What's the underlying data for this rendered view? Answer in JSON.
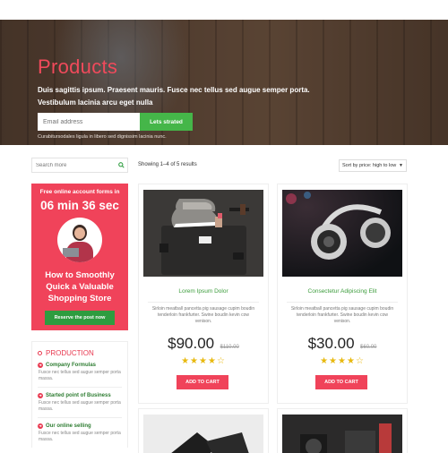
{
  "hero": {
    "title": "Products",
    "text": "Duis sagittis ipsum. Praesent mauris. Fusce nec tellus sed augue semper porta. Vestibulum lacinia arcu eget nulla",
    "email_placeholder": "Email address",
    "button_label": "Lets strated",
    "small_text": "Curabitursodales ligula in libero sed dignissim lacinia nunc."
  },
  "toolbar": {
    "search_placeholder": "Search more",
    "showing_text": "Showing 1–4 of 5 results",
    "sort_label": "Sort by price: high to low"
  },
  "promo": {
    "top_text": "Free online account forms in",
    "timer": "06 min 36 sec",
    "title": "How to Smoothly Quick a Valuable Shopping Store",
    "button_label": "Reserve the post now"
  },
  "sidebar": {
    "heading": "PRODUCTION",
    "items": [
      {
        "title": "Company Formulas",
        "text": "Fusce nec tellus sed augue semper porta massa."
      },
      {
        "title": "Started point of Business",
        "text": "Fusce nec tellus sed augue semper porta massa."
      },
      {
        "title": "Our online selling",
        "text": "Fusce nec tellus sed augue semper porta massa."
      }
    ]
  },
  "products": [
    {
      "name": "Lorem Ipsum Dolor",
      "desc": "Sirloin meatball pancetta pig sausage cupim boudin tenderloin frankfurter. Swine boudin kevin cow venison.",
      "price": "$90.00",
      "old_price": "$110.00",
      "stars": "★★★★",
      "empty_stars": "☆",
      "cart_label": "ADD TO CART",
      "image_icon": "shoes-image"
    },
    {
      "name": "Consectetur Adipiscing Elit",
      "desc": "Sirloin meatball pancetta pig sausage cupim boudin tenderloin frankfurter. Swine boudin kevin cow venison.",
      "price": "$30.00",
      "old_price": "$60.00",
      "stars": "★★★★",
      "empty_stars": "☆",
      "cart_label": "ADD TO CART",
      "image_icon": "headphones-image"
    }
  ],
  "colors": {
    "accent_red": "#f0435a",
    "accent_green": "#45b649",
    "star_yellow": "#e8b90f"
  }
}
